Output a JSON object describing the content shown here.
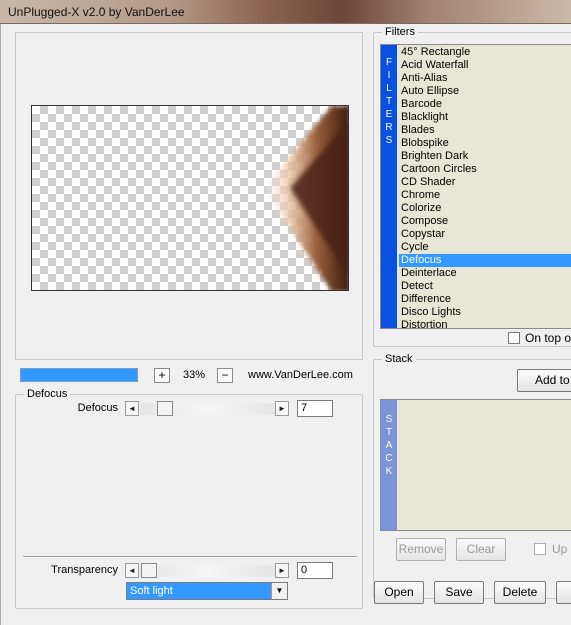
{
  "window": {
    "title": "UnPlugged-X v2.0 by VanDerLee"
  },
  "preview": {
    "progress": 1.0,
    "zoom_in": "+",
    "zoom_value": "33%",
    "zoom_out": "−",
    "url": "www.VanDerLee.com"
  },
  "defocus_group": {
    "label": "Defocus",
    "slider_label": "Defocus",
    "value": "7",
    "left_arrow": "◄",
    "right_arrow": "►"
  },
  "transparency": {
    "label": "Transparency",
    "value": "0",
    "left_arrow": "◄",
    "right_arrow": "►"
  },
  "blend_mode": {
    "value": "Soft light",
    "arrow": "▼"
  },
  "filters": {
    "label": "Filters",
    "bar_letters": [
      "F",
      "I",
      "L",
      "T",
      "E",
      "R",
      "S"
    ],
    "items": [
      "45° Rectangle",
      "Acid Waterfall",
      "Anti-Alias",
      "Auto Ellipse",
      "Barcode",
      "Blacklight",
      "Blades",
      "Blobspike",
      "Brighten Dark",
      "Cartoon Circles",
      "CD Shader",
      "Chrome",
      "Colorize",
      "Compose",
      "Copystar",
      "Cycle",
      "Defocus",
      "Deinterlace",
      "Detect",
      "Difference",
      "Disco Lights",
      "Distortion"
    ],
    "selected": "Defocus",
    "on_top_label": "On top o"
  },
  "stack": {
    "label": "Stack",
    "bar_letters": [
      "S",
      "T",
      "A",
      "C",
      "K"
    ],
    "add_button": "Add to s",
    "remove_button": "Remove",
    "clear_button": "Clear",
    "up_label": "Up"
  },
  "footer": {
    "open_button": "Open",
    "save_button": "Save",
    "delete_button": "Delete"
  },
  "colors": {
    "selection": "#3399ff",
    "filters_bar": "#0a50e0",
    "stack_bar": "#7b93d8",
    "list_bg": "#e8e6d6"
  }
}
